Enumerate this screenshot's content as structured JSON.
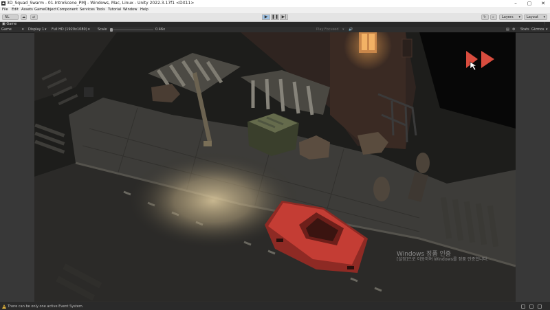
{
  "window": {
    "title": "3D_Squad_Swarm - 01.IntroScene_PMJ - Windows, Mac, Linux - Unity 2022.3.17f1 <DX11>",
    "controls": [
      "minimize",
      "maximize",
      "close"
    ]
  },
  "menu": [
    "File",
    "Edit",
    "Assets",
    "GameObject",
    "Component",
    "Services",
    "Tools",
    "Tutorial",
    "Window",
    "Help"
  ],
  "toolbar": {
    "account_label": "NL",
    "layers_label": "Layers",
    "layout_label": "Layout",
    "play_active": true
  },
  "game_view": {
    "tab_label": "Game",
    "view_mode": "Game",
    "display": "Display 1",
    "resolution": "Full HD (1920x1080)",
    "scale_label": "Scale",
    "scale_value": "0.46x",
    "play_focused": "Play Focused",
    "stats": "Stats",
    "gizmos": "Gizmos"
  },
  "watermark": {
    "line1": "Windows 정품 인증",
    "line2": "[설정]으로 이동하여 Windows를 정품 인증합니다."
  },
  "status": {
    "message": "There can be only one active Event System."
  },
  "colors": {
    "car": "#c43d34",
    "fast_forward": "#d84c3e",
    "window_light": "#f2a651",
    "lamp_glow": "#e3cfa1",
    "accent_play": "#9fc3e5"
  }
}
